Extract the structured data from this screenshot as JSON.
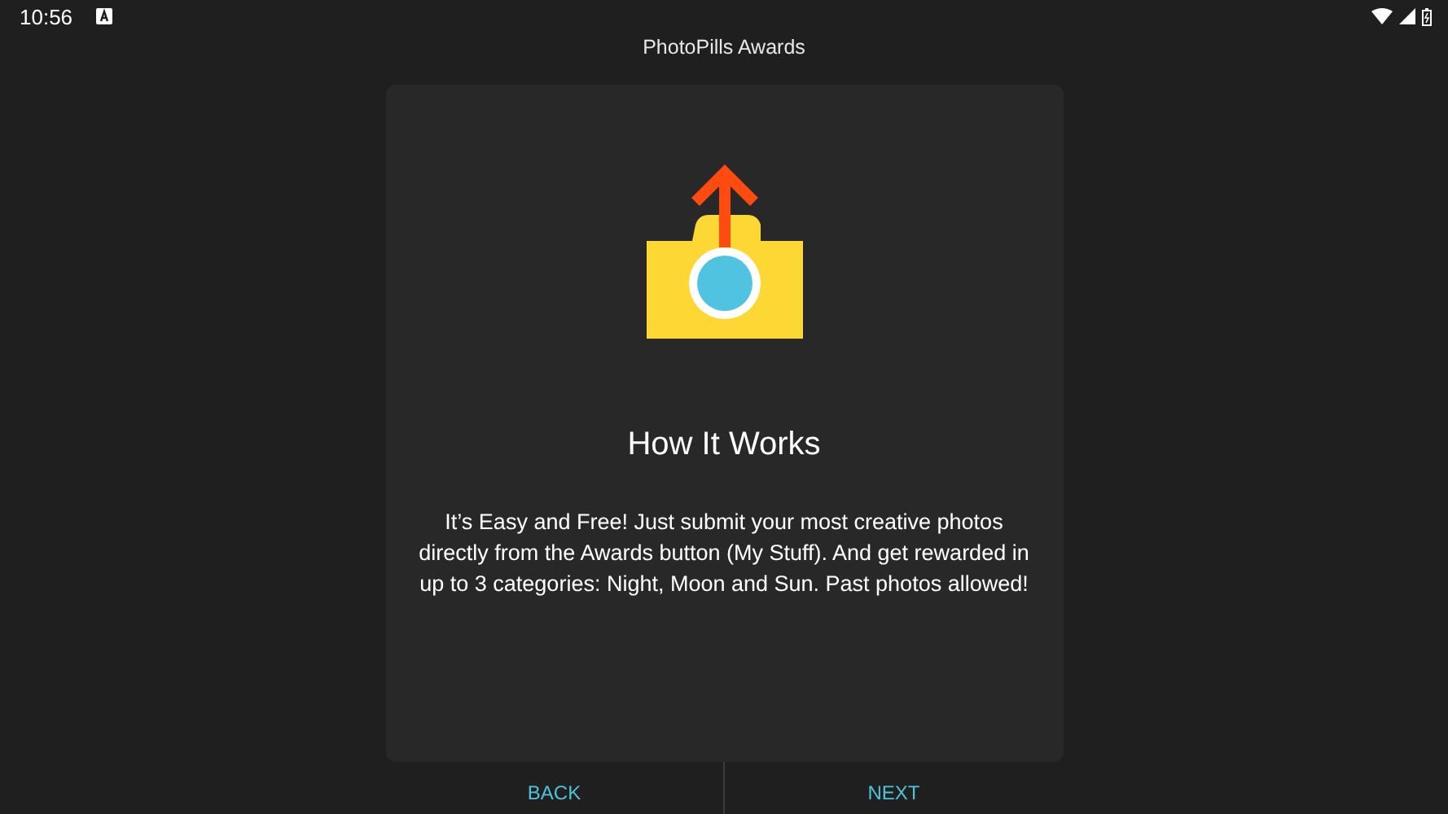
{
  "status_bar": {
    "time": "10:56"
  },
  "window": {
    "title": "PhotoPills Awards"
  },
  "card": {
    "heading": "How It Works",
    "body": "It’s Easy and Free! Just submit your most creative photos directly from the Awards button (My Stuff). And get rewarded in up to 3 categories: Night, Moon and Sun. Past photos allowed!"
  },
  "buttons": [
    "BACK",
    "NEXT"
  ]
}
